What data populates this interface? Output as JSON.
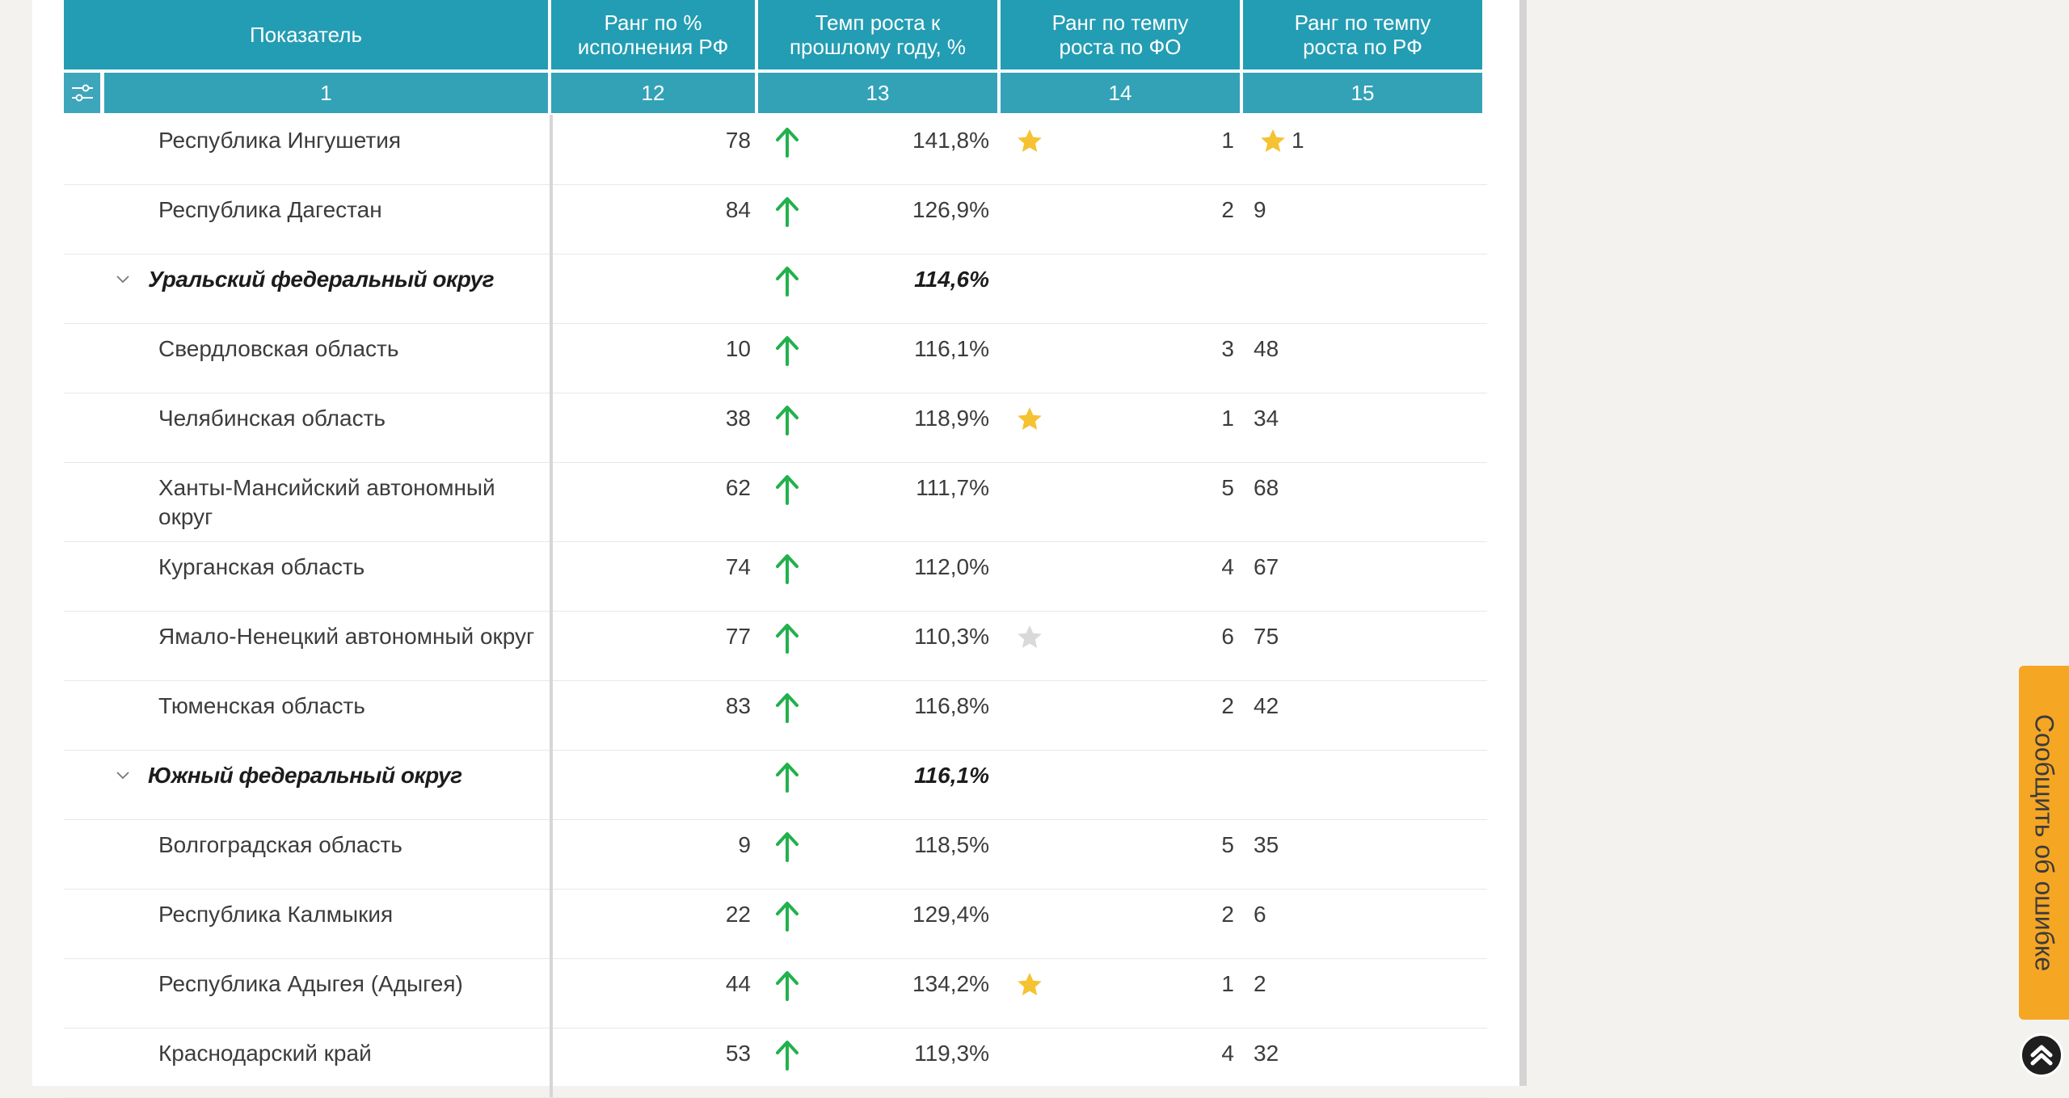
{
  "header": {
    "col_name": "Показатель",
    "col_rank_rf": "Ранг по %\nисполнения РФ",
    "col_rate": "Темп роста к\nпрошлому году, %",
    "col_rank_fo": "Ранг по темпу\nроста по ФО",
    "col_rank_rate_rf": "Ранг по темпу\nроста по РФ"
  },
  "col_numbers": [
    "1",
    "12",
    "13",
    "14",
    "15"
  ],
  "rows": [
    {
      "name": "Республика Ингушетия",
      "rank": "78",
      "rate": "141,8%",
      "fo": "1",
      "rf": "1"
    },
    {
      "name": "Республика Дагестан",
      "rank": "84",
      "rate": "126,9%",
      "fo": "2",
      "rf": "9"
    },
    {
      "name": "Уральский федеральный округ",
      "rank": "",
      "rate": "114,6%",
      "fo": "",
      "rf": ""
    },
    {
      "name": "Свердловская область",
      "rank": "10",
      "rate": "116,1%",
      "fo": "3",
      "rf": "48"
    },
    {
      "name": "Челябинская область",
      "rank": "38",
      "rate": "118,9%",
      "fo": "1",
      "rf": "34"
    },
    {
      "name": "Ханты-Мансийский автономный\nокруг",
      "rank": "62",
      "rate": "111,7%",
      "fo": "5",
      "rf": "68"
    },
    {
      "name": "Курганская область",
      "rank": "74",
      "rate": "112,0%",
      "fo": "4",
      "rf": "67"
    },
    {
      "name": "Ямало-Ненецкий автономный округ",
      "rank": "77",
      "rate": "110,3%",
      "fo": "6",
      "rf": "75"
    },
    {
      "name": "Тюменская область",
      "rank": "83",
      "rate": "116,8%",
      "fo": "2",
      "rf": "42"
    },
    {
      "name": "Южный федеральный округ",
      "rank": "",
      "rate": "116,1%",
      "fo": "",
      "rf": ""
    },
    {
      "name": "Волгоградская область",
      "rank": "9",
      "rate": "118,5%",
      "fo": "5",
      "rf": "35"
    },
    {
      "name": "Республика Калмыкия",
      "rank": "22",
      "rate": "129,4%",
      "fo": "2",
      "rf": "6"
    },
    {
      "name": "Республика Адыгея (Адыгея)",
      "rank": "44",
      "rate": "134,2%",
      "fo": "1",
      "rf": "2"
    },
    {
      "name": "Краснодарский край",
      "rank": "53",
      "rate": "119,3%",
      "fo": "4",
      "rf": "32"
    }
  ],
  "report_error": "Сообщить об ошибке",
  "colors": {
    "header_bg": "#239db3",
    "arrow_up": "#22b14c",
    "star_gold": "#f5c232",
    "star_grey": "#d9d9d9",
    "report_tab": "#f5a623"
  }
}
